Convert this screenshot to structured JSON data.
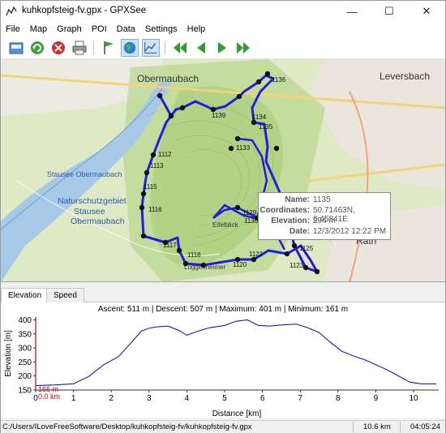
{
  "window": {
    "title": "kuhkopfsteig-fv.gpx - GPXSee",
    "minimize": "—",
    "maximize": "☐",
    "close": "✕"
  },
  "menu": [
    "File",
    "Map",
    "Graph",
    "POI",
    "Data",
    "Settings",
    "Help"
  ],
  "toolbar": {
    "icons": [
      "open-icon",
      "reload-icon",
      "close-file-icon",
      "print-icon",
      "show-poi-icon",
      "show-map-icon",
      "show-graphs-icon",
      "first-icon",
      "previous-icon",
      "next-icon",
      "last-icon"
    ]
  },
  "map": {
    "places": [
      "Obermaubach",
      "Leversbach",
      "Stausee Obermaubach",
      "Naturschutzgebiet",
      "Stausee",
      "Obermaubach",
      "Rath",
      "Eifelblick",
      "Luggenheimer"
    ],
    "waypoints": [
      "1136",
      "1139",
      "1133",
      "1135",
      "1112",
      "1113",
      "1115",
      "1116",
      "1117",
      "1118",
      "1120",
      "1121",
      "1129",
      "1130",
      "1131",
      "1127",
      "1125",
      "1123",
      "1134"
    ],
    "tooltip": {
      "name_label": "Name:",
      "name": "1135",
      "coords_label": "Coordinates:",
      "coords": "50.71463N, 6.45841E",
      "elev_label": "Elevation:",
      "elev": "294 m",
      "date_label": "Date:",
      "date": "12/3/2012 12:22 PM"
    },
    "scale": {
      "ticks": [
        "0",
        "200",
        "400",
        "600"
      ],
      "unit": "m"
    }
  },
  "tabs": [
    "Elevation",
    "Speed"
  ],
  "graph": {
    "info": "Ascent: 511 m  |  Descent: 507 m  |  Maximum: 401 m  |  Minimum: 161 m",
    "marker_elev": "166 m",
    "marker_dist": "0.0 km"
  },
  "chart_data": {
    "type": "line",
    "xlabel": "Distance [km]",
    "ylabel": "Elevation [m]",
    "xlim": [
      0,
      10.6
    ],
    "ylim": [
      150,
      410
    ],
    "xticks": [
      0,
      1,
      2,
      3,
      4,
      5,
      6,
      7,
      8,
      9,
      10
    ],
    "yticks": [
      150,
      200,
      250,
      300,
      350,
      400
    ],
    "x": [
      0,
      0.5,
      1.0,
      1.4,
      1.8,
      2.2,
      2.5,
      2.8,
      3.0,
      3.2,
      3.5,
      3.8,
      4.0,
      4.3,
      4.6,
      5.0,
      5.3,
      5.6,
      5.9,
      6.2,
      6.5,
      6.9,
      7.2,
      7.5,
      7.8,
      8.1,
      8.4,
      8.7,
      9.0,
      9.3,
      9.6,
      9.9,
      10.2,
      10.6
    ],
    "y": [
      166,
      168,
      172,
      198,
      240,
      270,
      315,
      360,
      370,
      375,
      378,
      362,
      345,
      360,
      372,
      380,
      395,
      400,
      380,
      378,
      382,
      385,
      372,
      355,
      320,
      288,
      272,
      258,
      240,
      222,
      200,
      178,
      172,
      172
    ]
  },
  "status": {
    "path": "C:/Users/ILoveFreeSoftware/Desktop/kuhkopfsteig-fv/kuhkopfsteig-fv.gpx",
    "distance": "10.6 km",
    "time": "04:05:24"
  },
  "colors": {
    "track": "#1e1edb",
    "graph_line": "#0000c8",
    "marker": "#d80000"
  }
}
